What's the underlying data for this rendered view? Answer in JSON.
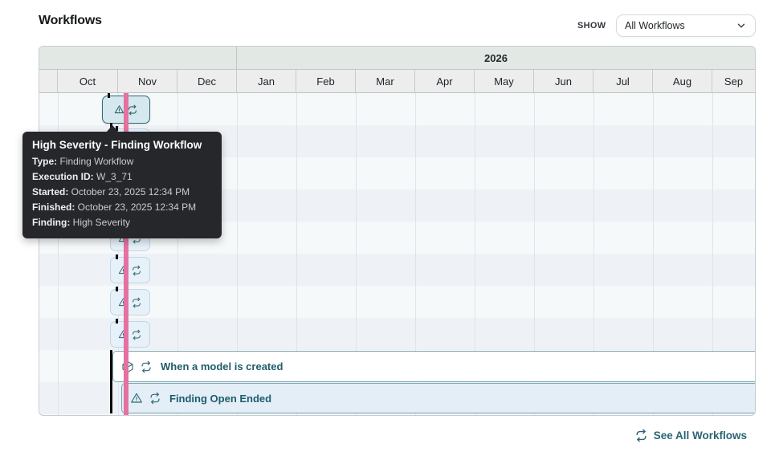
{
  "page": {
    "title": "Workflows"
  },
  "toolbar": {
    "show_label": "SHOW",
    "filter_value": "All Workflows"
  },
  "timeline": {
    "year": "2026",
    "months": [
      "Oct",
      "Nov",
      "Dec",
      "Jan",
      "Feb",
      "Mar",
      "Apr",
      "May",
      "Jun",
      "Jul",
      "Aug",
      "Sep"
    ],
    "executions": [
      {
        "row": 0,
        "highlighted": true
      },
      {
        "row": 1,
        "highlighted": false
      },
      {
        "row": 2,
        "highlighted": false
      },
      {
        "row": 3,
        "highlighted": false
      },
      {
        "row": 4,
        "highlighted": false
      },
      {
        "row": 5,
        "highlighted": false
      },
      {
        "row": 6,
        "highlighted": false
      },
      {
        "row": 7,
        "highlighted": false
      }
    ],
    "bars": [
      {
        "label": "When a model is created",
        "icon": "box-icon",
        "variant": "trigger"
      },
      {
        "label": "Finding Open Ended",
        "icon": "warning-icon",
        "variant": "finding"
      }
    ]
  },
  "tooltip": {
    "title": "High Severity - Finding Workflow",
    "fields": [
      {
        "label": "Type:",
        "value": "Finding Workflow"
      },
      {
        "label": "Execution ID:",
        "value": "W_3_71"
      },
      {
        "label": "Started:",
        "value": "October 23, 2025 12:34 PM"
      },
      {
        "label": "Finished:",
        "value": "October 23, 2025 12:34 PM"
      },
      {
        "label": "Finding:",
        "value": "High Severity"
      }
    ]
  },
  "footer": {
    "see_all_label": "See All Workflows"
  },
  "colors": {
    "accent_teal": "#2f6b77",
    "chip_bg": "#e7f1f9",
    "chip_border": "#bed7e7",
    "chip_highlight_bg": "#d4e8ee",
    "now_line_pink": "#e4719f",
    "tooltip_bg": "#26272b",
    "bar_border": "#7ba6b1",
    "year_header_bg": "#e2e8e4",
    "month_header_bg": "#ededed"
  }
}
